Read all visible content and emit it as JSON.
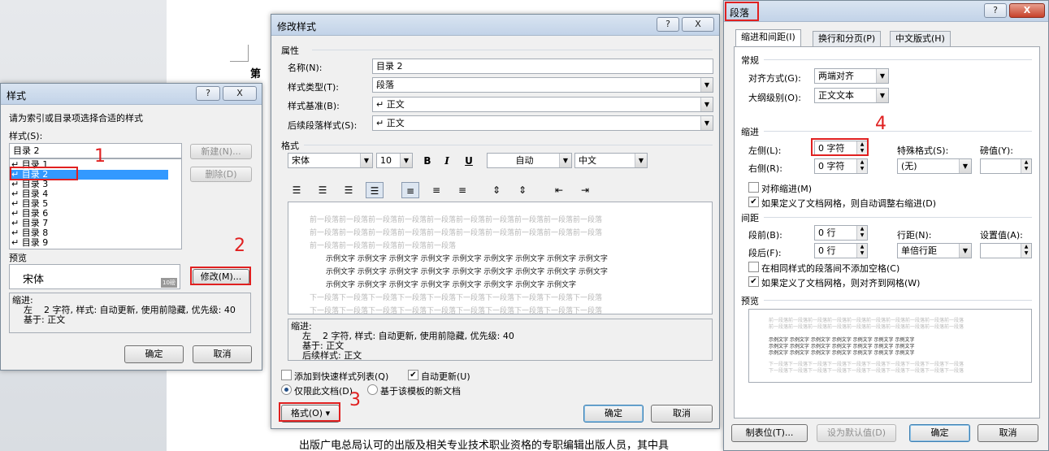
{
  "document": {
    "heading_char": "第",
    "bottom_text": "出版广电总局认可的出版及相关专业技术职业资格的专职编辑出版人员，其中具"
  },
  "style_dialog": {
    "title": "样式",
    "help_label": "?",
    "close_label": "X",
    "prompt": "请为索引或目录项选择合适的样式",
    "styles_label": "样式(S):",
    "current_style": "目录 2",
    "items": [
      "目录 1",
      "目录 2",
      "目录 3",
      "目录 4",
      "目录 5",
      "目录 6",
      "目录 7",
      "目录 8",
      "目录 9"
    ],
    "selected_index": 1,
    "new_button": "新建(N)...",
    "delete_button": "删除(D)",
    "preview_label": "预览",
    "preview_font": "宋体",
    "preview_size": "10磅",
    "modify_button": "修改(M)...",
    "description": "缩进:\n    左    2 字符, 样式: 自动更新, 使用前隐藏, 优先级: 40\n    基于: 正文",
    "ok_button": "确定",
    "cancel_button": "取消"
  },
  "modify_dialog": {
    "title": "修改样式",
    "help_label": "?",
    "close_label": "X",
    "properties_label": "属性",
    "name_label": "名称(N):",
    "name_value": "目录 2",
    "type_label": "样式类型(T):",
    "type_value": "段落",
    "base_label": "样式基准(B):",
    "base_value": "↵ 正文",
    "next_label": "后续段落样式(S):",
    "next_value": "↵ 正文",
    "format_label": "格式",
    "font": "宋体",
    "size": "10",
    "bold": "B",
    "italic": "I",
    "underline": "U",
    "color": "自动",
    "script": "中文",
    "prev_para_text": "前一段落前一段落前一段落前一段落前一段落前一段落前一段落前一段落前一段落前一段落",
    "prev_para_last": "前一段落前一段落前一段落前一段落前一段落",
    "sample_text": "示例文字 示例文字 示例文字 示例文字 示例文字 示例文字 示例文字 示例文字 示例文字",
    "sample_last": "示例文字 示例文字 示例文字 示例文字 示例文字 示例文字 示例文字 示例文字",
    "next_para_text": "下一段落下一段落下一段落下一段落下一段落下一段落下一段落下一段落下一段落下一段落",
    "description": "缩进:\n    左    2 字符, 样式: 自动更新, 使用前隐藏, 优先级: 40\n    基于: 正文\n    后续样式: 正文",
    "add_quick_label": "添加到快速样式列表(Q)",
    "add_quick_checked": false,
    "auto_update_label": "自动更新(U)",
    "auto_update_checked": true,
    "only_doc_label": "仅限此文档(D)",
    "template_label": "基于该模板的新文档",
    "format_button": "格式(O) ▾",
    "ok_button": "确定",
    "cancel_button": "取消"
  },
  "paragraph_dialog": {
    "title": "段落",
    "help_label": "?",
    "close_label": "X",
    "tabs": [
      "缩进和间距(I)",
      "换行和分页(P)",
      "中文版式(H)"
    ],
    "general_label": "常规",
    "align_label": "对齐方式(G):",
    "align_value": "两端对齐",
    "outline_label": "大纲级别(O):",
    "outline_value": "正文文本",
    "indent_label": "缩进",
    "left_label": "左侧(L):",
    "left_value": "0 字符",
    "right_label": "右侧(R):",
    "right_value": "0 字符",
    "special_label": "特殊格式(S):",
    "special_value": "(无)",
    "by_label": "磅值(Y):",
    "by_value": "",
    "mirror_label": "对称缩进(M)",
    "mirror_checked": false,
    "auto_right_label": "如果定义了文档网格，则自动调整右缩进(D)",
    "auto_right_checked": true,
    "spacing_label": "间距",
    "before_label": "段前(B):",
    "before_value": "0 行",
    "after_label": "段后(F):",
    "after_value": "0 行",
    "line_label": "行距(N):",
    "line_value": "单倍行距",
    "at_label": "设置值(A):",
    "at_value": "",
    "no_space_label": "在相同样式的段落间不添加空格(C)",
    "no_space_checked": false,
    "snap_label": "如果定义了文档网格，则对齐到网格(W)",
    "snap_checked": true,
    "preview_label": "预览",
    "prev_text": "前一段落前一段落前一段落前一段落前一段落前一段落前一段落前一段落前一段落前一段落",
    "sample_text": "示例文字 示例文字 示例文字 示例文字 示例文字 示例文字 示例文字",
    "next_text": "下一段落下一段落下一段落下一段落下一段落下一段落下一段落下一段落下一段落下一段落",
    "tabs_button": "制表位(T)...",
    "default_button": "设为默认值(D)",
    "ok_button": "确定",
    "cancel_button": "取消"
  },
  "annotations": [
    "1",
    "2",
    "3",
    "4"
  ],
  "colors": {
    "accent": "#e02020",
    "selection": "#3399ff"
  }
}
